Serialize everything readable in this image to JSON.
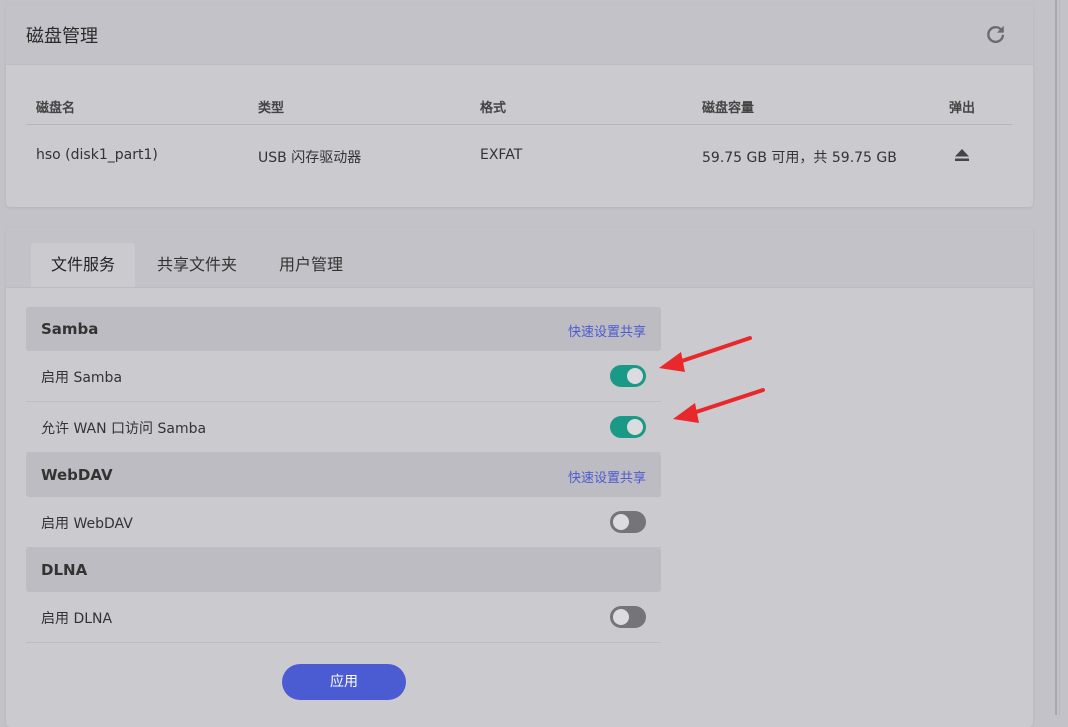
{
  "disk": {
    "title": "磁盘管理",
    "headers": [
      "磁盘名",
      "类型",
      "格式",
      "磁盘容量",
      "弹出"
    ],
    "rows": [
      [
        "hso (disk1_part1)",
        "USB 闪存驱动器",
        "EXFAT",
        "59.75 GB 可用，共 59.75 GB"
      ]
    ]
  },
  "tabs": [
    "文件服务",
    "共享文件夹",
    "用户管理"
  ],
  "sections": {
    "samba": {
      "title": "Samba",
      "link": "快速设置共享",
      "enable_label": "启用 Samba",
      "enable_on": true,
      "wan_label": "允许 WAN 口访问 Samba",
      "wan_on": true
    },
    "webdav": {
      "title": "WebDAV",
      "link": "快速设置共享",
      "enable_label": "启用 WebDAV",
      "enable_on": false
    },
    "dlna": {
      "title": "DLNA",
      "enable_label": "启用 DLNA",
      "enable_on": false
    }
  },
  "apply_label": "应用",
  "colors": {
    "accent": "#4b5bd1",
    "toggle_on": "#1a9a86",
    "link": "#4a5bd0",
    "annotation_arrow": "#e8282b"
  },
  "icons": [
    "refresh-icon",
    "eject-icon",
    "red-arrow-annotation"
  ]
}
